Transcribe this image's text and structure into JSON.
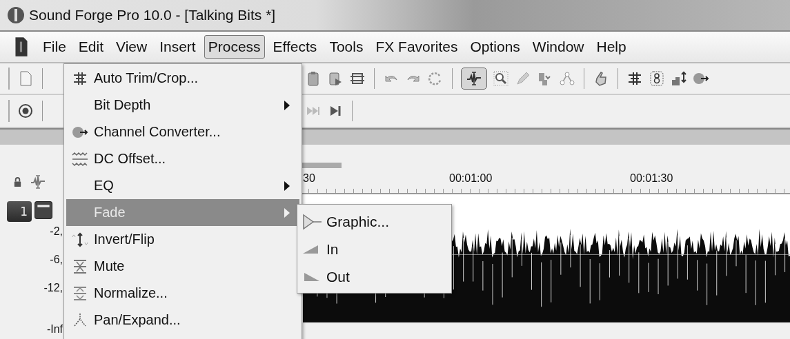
{
  "window": {
    "title": "Sound Forge Pro 10.0 - [Talking Bits *]"
  },
  "menu_bar": [
    {
      "label": "File",
      "selected": false
    },
    {
      "label": "Edit",
      "selected": false
    },
    {
      "label": "View",
      "selected": false
    },
    {
      "label": "Insert",
      "selected": false
    },
    {
      "label": "Process",
      "selected": true
    },
    {
      "label": "Effects",
      "selected": false
    },
    {
      "label": "Tools",
      "selected": false
    },
    {
      "label": "FX Favorites",
      "selected": false
    },
    {
      "label": "Options",
      "selected": false
    },
    {
      "label": "Window",
      "selected": false
    },
    {
      "label": "Help",
      "selected": false
    }
  ],
  "process_menu": [
    {
      "label": "Auto Trim/Crop...",
      "kind": "trim",
      "submenu": false,
      "selected": false
    },
    {
      "label": "Bit Depth",
      "kind": "plain",
      "submenu": true,
      "selected": false
    },
    {
      "label": "Channel Converter...",
      "kind": "channel",
      "submenu": false,
      "selected": false
    },
    {
      "label": "DC Offset...",
      "kind": "offset",
      "submenu": false,
      "selected": false
    },
    {
      "label": "EQ",
      "kind": "plain",
      "submenu": true,
      "selected": false
    },
    {
      "label": "Fade",
      "kind": "plain",
      "submenu": true,
      "selected": true
    },
    {
      "label": "Invert/Flip",
      "kind": "invert",
      "submenu": false,
      "selected": false
    },
    {
      "label": "Mute",
      "kind": "mute",
      "submenu": false,
      "selected": false
    },
    {
      "label": "Normalize...",
      "kind": "normalize",
      "submenu": false,
      "selected": false
    },
    {
      "label": "Pan/Expand...",
      "kind": "pan",
      "submenu": false,
      "selected": false
    }
  ],
  "fade_submenu": [
    {
      "label": "Graphic...",
      "kind": "graphic"
    },
    {
      "label": "In",
      "kind": "fade-in"
    },
    {
      "label": "Out",
      "kind": "fade-out"
    }
  ],
  "track": {
    "number": "1",
    "scale": [
      "-2,",
      "-6,",
      "-12,",
      "-Inf"
    ]
  },
  "ruler": {
    "labels": [
      "30",
      "00:01:00",
      "00:01:30"
    ]
  }
}
